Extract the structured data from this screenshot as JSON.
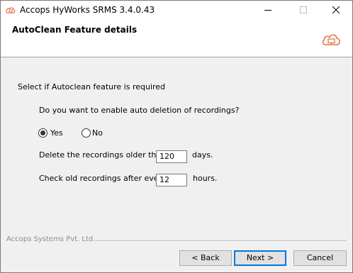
{
  "window": {
    "title": "Accops HyWorks SRMS 3.4.0.43",
    "icon": "accops-cloud-icon",
    "controls": {
      "minimize": "minimize-icon",
      "maximize": "maximize-icon",
      "close": "close-icon"
    }
  },
  "header": {
    "title": "AutoClean Feature details",
    "logo": "accops-cloud-monitor-logo",
    "accent_color": "#e8734a"
  },
  "content": {
    "section_prompt": "Select if Autoclean feature is required",
    "question": "Do you want to enable auto deletion of recordings?",
    "options": [
      {
        "label": "Yes",
        "selected": true
      },
      {
        "label": "No",
        "selected": false
      }
    ],
    "delete_older": {
      "label": "Delete the recordings older than",
      "value": "120",
      "unit": "days."
    },
    "check_every": {
      "label": "Check old recordings after every",
      "value": "12",
      "unit": "hours."
    }
  },
  "footer": {
    "brand": "Accops Systems Pvt. Ltd.",
    "back_label": "< Back",
    "next_label": "Next >",
    "cancel_label": "Cancel"
  }
}
